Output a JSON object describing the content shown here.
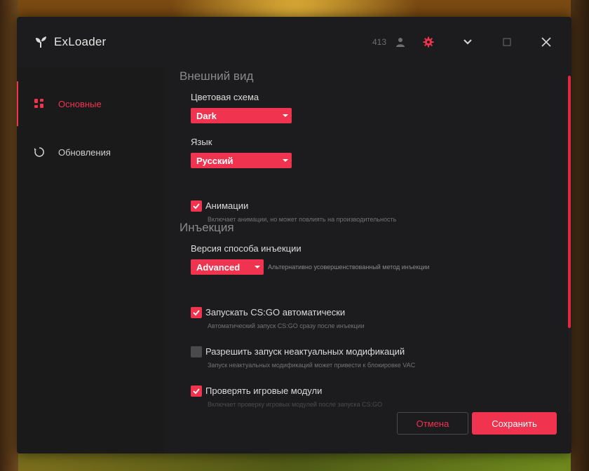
{
  "app": {
    "title": "ExLoader",
    "user_count": "413"
  },
  "colors": {
    "accent": "#f0334f",
    "bg": "#1c1c1e"
  },
  "titlebar": {
    "icons": [
      "user-icon",
      "gear-icon",
      "chevron-down-icon",
      "maximize-icon",
      "close-icon"
    ]
  },
  "sidebar": {
    "items": [
      {
        "label": "Основные",
        "icon": "grid-icon",
        "active": true
      },
      {
        "label": "Обновления",
        "icon": "refresh-icon",
        "active": false
      }
    ]
  },
  "appearance": {
    "title": "Внешний вид",
    "color_scheme": {
      "label": "Цветовая схема",
      "value": "Dark"
    },
    "language": {
      "label": "Язык",
      "value": "Русский"
    },
    "animations": {
      "label": "Анимации",
      "checked": true,
      "hint": "Включает анимации, но может повлиять на производительность"
    }
  },
  "injection": {
    "title": "Инъекция",
    "method": {
      "label": "Версия способа инъекции",
      "value": "Advanced",
      "hint": "Альтернативно усовершенствованный метод инъекции"
    },
    "autostart": {
      "label": "Запускать CS:GO автоматически",
      "checked": true,
      "hint": "Автоматический запуск CS:GO сразу после инъекции"
    },
    "outdated": {
      "label": "Разрешить запуск неактуальных модификаций",
      "checked": false,
      "hint": "Запуск неактуальных модификаций может привести к блокировке VAC"
    },
    "verify": {
      "label": "Проверять игровые модули",
      "checked": true,
      "hint": "Включает проверку игровых модулей после запуска CS:GO"
    }
  },
  "footer": {
    "cancel_label": "Отмена",
    "save_label": "Сохранить"
  }
}
